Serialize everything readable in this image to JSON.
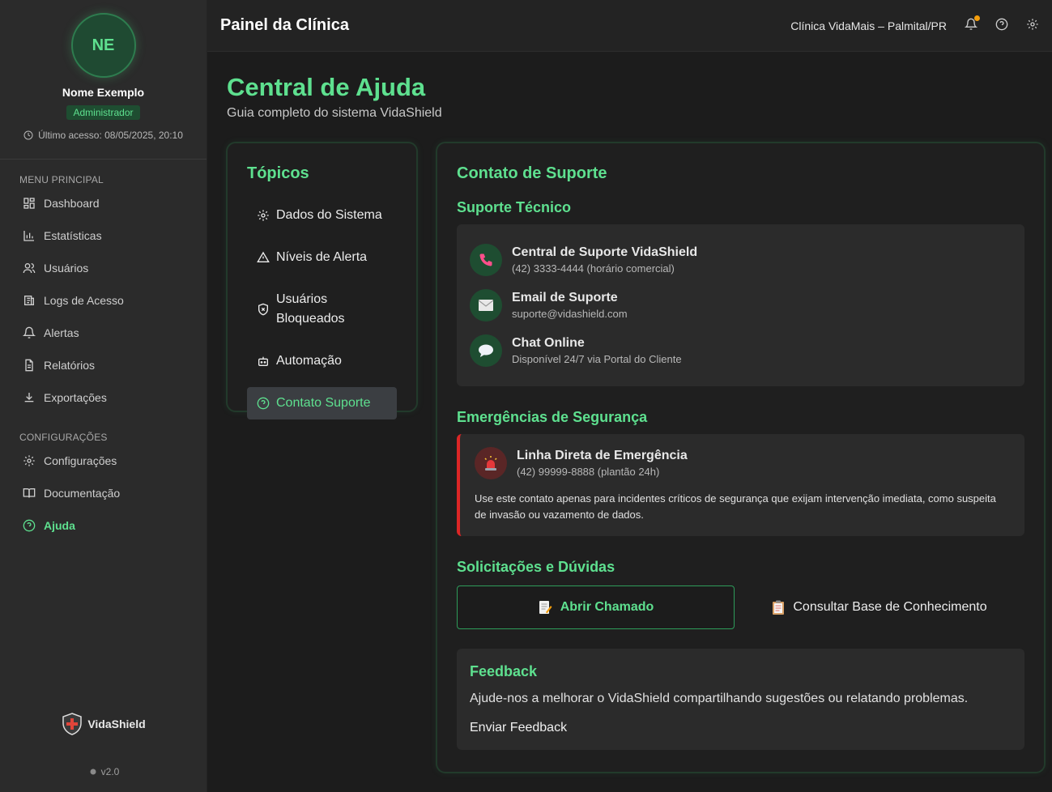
{
  "sidebar": {
    "avatar_initials": "NE",
    "user_name": "Nome Exemplo",
    "role": "Administrador",
    "last_access": "Último acesso: 08/05/2025, 20:10",
    "main_menu_title": "MENU PRINCIPAL",
    "main_menu": [
      {
        "label": "Dashboard",
        "icon": "dashboard-icon"
      },
      {
        "label": "Estatísticas",
        "icon": "bar-chart-icon"
      },
      {
        "label": "Usuários",
        "icon": "users-icon"
      },
      {
        "label": "Logs de Acesso",
        "icon": "logs-icon"
      },
      {
        "label": "Alertas",
        "icon": "bell-icon"
      },
      {
        "label": "Relatórios",
        "icon": "report-icon"
      },
      {
        "label": "Exportações",
        "icon": "download-icon"
      }
    ],
    "settings_title": "CONFIGURAÇÕES",
    "settings_menu": [
      {
        "label": "Configurações",
        "icon": "gear-icon"
      },
      {
        "label": "Documentação",
        "icon": "book-icon"
      },
      {
        "label": "Ajuda",
        "icon": "help-icon",
        "active": true
      }
    ],
    "brand": "VidaShield",
    "version": "v2.0"
  },
  "header": {
    "title": "Painel da Clínica",
    "clinic": "Clínica VidaMais – Palmital/PR"
  },
  "page": {
    "title": "Central de Ajuda",
    "subtitle": "Guia completo do sistema VidaShield"
  },
  "topics": {
    "title": "Tópicos",
    "items": [
      {
        "label": "Dados do Sistema",
        "icon": "gear-icon"
      },
      {
        "label": "Níveis de Alerta",
        "icon": "warning-icon"
      },
      {
        "label": "Usuários Bloqueados",
        "icon": "shield-x-icon"
      },
      {
        "label": "Automação",
        "icon": "robot-icon"
      },
      {
        "label": "Contato Suporte",
        "icon": "help-icon",
        "active": true
      }
    ]
  },
  "content": {
    "title": "Contato de Suporte",
    "tech_title": "Suporte Técnico",
    "contacts": [
      {
        "title": "Central de Suporte VidaShield",
        "sub": "(42) 3333-4444 (horário comercial)",
        "icon": "phone-icon"
      },
      {
        "title": "Email de Suporte",
        "sub": "suporte@vidashield.com",
        "icon": "envelope-icon"
      },
      {
        "title": "Chat Online",
        "sub": "Disponível 24/7 via Portal do Cliente",
        "icon": "chat-icon"
      }
    ],
    "emergency_title": "Emergências de Segurança",
    "emergency": {
      "title": "Linha Direta de Emergência",
      "sub": "(42) 99999-8888 (plantão 24h)",
      "text": "Use este contato apenas para incidentes críticos de segurança que exijam intervenção imediata, como suspeita de invasão ou vazamento de dados."
    },
    "requests_title": "Solicitações e Dúvidas",
    "open_ticket": "Abrir Chamado",
    "knowledge_base": "Consultar Base de Conhecimento",
    "feedback": {
      "title": "Feedback",
      "text": "Ajude-nos a melhorar o VidaShield compartilhando sugestões ou relatando problemas.",
      "link": "Enviar Feedback"
    }
  }
}
